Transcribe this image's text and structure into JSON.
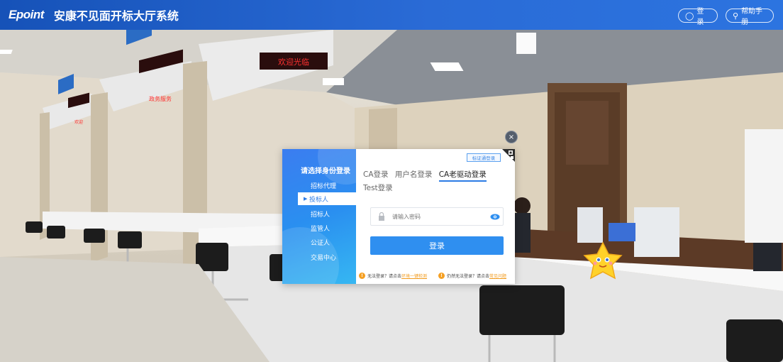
{
  "header": {
    "logo": "Epoint",
    "title": "安康不见面开标大厅系统",
    "login_label": "登录",
    "help_label": "帮助手册"
  },
  "scene": {
    "sign_welcome": "欢迎光临",
    "sign_window": "政务服务",
    "sign_small": "欢迎"
  },
  "modal": {
    "close_label": "×",
    "left_title": "请选择身份登录",
    "roles": [
      "招标代理",
      "投标人",
      "招标人",
      "监管人",
      "公证人",
      "交易中心"
    ],
    "active_role": "投标人",
    "cert_login_label": "标证通登录",
    "tabs": [
      "CA登录",
      "用户名登录",
      "CA老驱动登录",
      "Test登录"
    ],
    "active_tab": "CA老驱动登录",
    "password_placeholder": "请输入密码",
    "login_button": "登录",
    "notice1_prefix": "无法登录？请点击",
    "notice1_link": "环境一键检测",
    "notice2_prefix": "仍然无法登录？请点击",
    "notice2_link": "常见问题"
  },
  "colors": {
    "brand_blue": "#2c7be5",
    "button_blue": "#2f8ff0",
    "warning_orange": "#f5a023"
  }
}
